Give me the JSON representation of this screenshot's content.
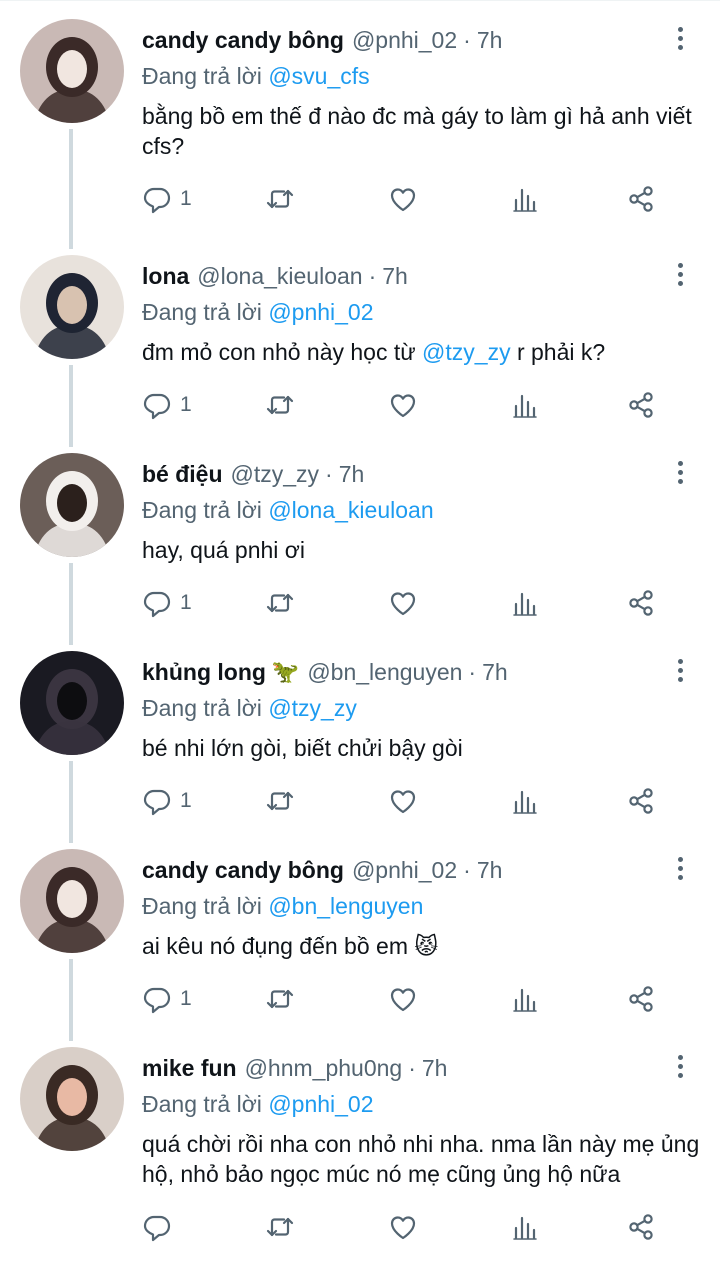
{
  "reply_prefix": "Đang trả lời",
  "tweets": [
    {
      "name": "candy candy bông",
      "emoji": "",
      "handle": "@pnhi_02",
      "time": "7h",
      "reply_to": "@svu_cfs",
      "text_parts": [
        {
          "t": "bằng bồ em thế đ nào đc mà gáy to làm gì hả anh viết cfs?",
          "mention": false
        }
      ],
      "reply_count": "1",
      "avatar_colors": [
        "#c9b9b5",
        "#3b2a28",
        "#f1e6e0"
      ]
    },
    {
      "name": "lona",
      "emoji": "",
      "handle": "@lona_kieuloan",
      "time": "7h",
      "reply_to": "@pnhi_02",
      "text_parts": [
        {
          "t": "đm mỏ con nhỏ này học từ ",
          "mention": false
        },
        {
          "t": "@tzy_zy",
          "mention": true
        },
        {
          "t": " r phải k?",
          "mention": false
        }
      ],
      "reply_count": "1",
      "avatar_colors": [
        "#e8e2dc",
        "#1f2433",
        "#d8c2b0"
      ]
    },
    {
      "name": "bé điệu",
      "emoji": "",
      "handle": "@tzy_zy",
      "time": "7h",
      "reply_to": "@lona_kieuloan",
      "text_parts": [
        {
          "t": "hay, quá pnhi ơi",
          "mention": false
        }
      ],
      "reply_count": "1",
      "avatar_colors": [
        "#6b5e58",
        "#f2efec",
        "#2b201c"
      ]
    },
    {
      "name": "khủng long",
      "emoji": "🦖",
      "handle": "@bn_lenguyen",
      "time": "7h",
      "reply_to": "@tzy_zy",
      "text_parts": [
        {
          "t": "bé nhi lớn gòi, biết chửi bậy gòi",
          "mention": false
        }
      ],
      "reply_count": "1",
      "avatar_colors": [
        "#1a1a22",
        "#3a3440",
        "#0d0d10"
      ]
    },
    {
      "name": "candy candy bông",
      "emoji": "",
      "handle": "@pnhi_02",
      "time": "7h",
      "reply_to": "@bn_lenguyen",
      "text_parts": [
        {
          "t": "ai kêu nó đụng đến bồ em 😾",
          "mention": false
        }
      ],
      "reply_count": "1",
      "avatar_colors": [
        "#c9b9b5",
        "#3b2a28",
        "#f1e6e0"
      ]
    },
    {
      "name": "mike fun",
      "emoji": "",
      "handle": "@hnm_phu0ng",
      "time": "7h",
      "reply_to": "@pnhi_02",
      "text_parts": [
        {
          "t": "quá chời rồi nha con nhỏ nhi nha. nma lần này mẹ ủng hộ, nhỏ bảo ngọc múc nó mẹ cũng ủng hộ nữa",
          "mention": false
        }
      ],
      "reply_count": "",
      "avatar_colors": [
        "#d9cfc8",
        "#3a2a24",
        "#e8b9a4"
      ]
    }
  ],
  "icons": {
    "reply": "reply-icon",
    "retweet": "retweet-icon",
    "like": "heart-icon",
    "views": "views-icon",
    "share": "share-icon",
    "more": "more-vertical-icon"
  },
  "colors": {
    "mention": "#1d9bf0",
    "secondary_text": "#536471",
    "thread_line": "#cfd9de"
  }
}
